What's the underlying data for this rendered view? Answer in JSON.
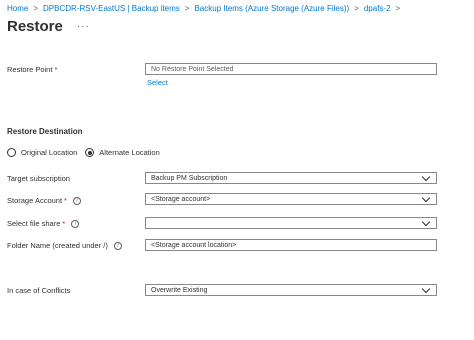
{
  "breadcrumb": {
    "items": [
      "Home",
      "DPBCDR-RSV-EastUS | Backup items",
      "Backup Items (Azure Storage (Azure Files))",
      "dpafs-2"
    ],
    "separator": ">"
  },
  "header": {
    "title": "Restore",
    "more": "···"
  },
  "restore_point": {
    "label": "Restore Point",
    "required_mark": "*",
    "value": "No Restore Point Selected",
    "select_link": "Select"
  },
  "destination": {
    "section_title": "Restore Destination",
    "options": [
      "Original Location",
      "Alternate Location"
    ],
    "selected": "Alternate Location"
  },
  "form": {
    "target_subscription": {
      "label": "Target subscription",
      "value": "Backup PM Subscription"
    },
    "storage_account": {
      "label": "Storage Account",
      "required_mark": "*",
      "value": "<Storage account>"
    },
    "file_share": {
      "label": "Select file share",
      "required_mark": "*",
      "value": ""
    },
    "folder_name": {
      "label": "Folder Name (created under /)",
      "value": "<Storage account location>"
    },
    "conflicts": {
      "label": "In case of Conflicts",
      "value": "Overwrite Existing"
    }
  },
  "icons": {
    "info": "info-icon",
    "dropdown": "chevron-down-icon"
  }
}
